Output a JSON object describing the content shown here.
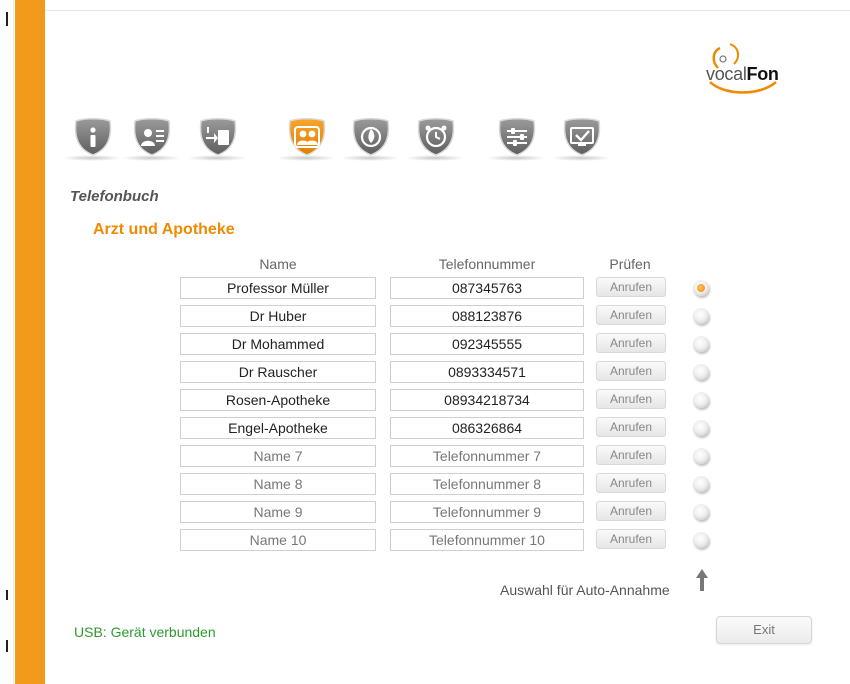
{
  "logo": {
    "part1": "vocal",
    "part2": "Fon"
  },
  "nav": [
    {
      "icon": "info-icon",
      "active": false
    },
    {
      "icon": "contact-card-icon",
      "active": false
    },
    {
      "icon": "phone-transfer-icon",
      "active": false
    },
    {
      "icon": "phonebook-people-icon",
      "active": true
    },
    {
      "icon": "emergency-flame-icon",
      "active": false
    },
    {
      "icon": "alarm-clock-icon",
      "active": false
    },
    {
      "icon": "settings-sliders-icon",
      "active": false
    },
    {
      "icon": "monitor-check-icon",
      "active": false
    }
  ],
  "section_title": "Telefonbuch",
  "sub_title": "Arzt und Apotheke",
  "columns": {
    "name": "Name",
    "phone": "Telefonnummer",
    "check": "Prüfen"
  },
  "call_label": "Anrufen",
  "rows": [
    {
      "name": "Professor Müller",
      "phone": "087345763",
      "placeholder": false,
      "selected": true
    },
    {
      "name": "Dr Huber",
      "phone": "088123876",
      "placeholder": false,
      "selected": false
    },
    {
      "name": "Dr Mohammed",
      "phone": "092345555",
      "placeholder": false,
      "selected": false
    },
    {
      "name": "Dr Rauscher",
      "phone": "0893334571",
      "placeholder": false,
      "selected": false
    },
    {
      "name": "Rosen-Apotheke",
      "phone": "08934218734",
      "placeholder": false,
      "selected": false
    },
    {
      "name": "Engel-Apotheke",
      "phone": "086326864",
      "placeholder": false,
      "selected": false
    },
    {
      "name": "Name 7",
      "phone": "Telefonnummer 7",
      "placeholder": true,
      "selected": false
    },
    {
      "name": "Name 8",
      "phone": "Telefonnummer 8",
      "placeholder": true,
      "selected": false
    },
    {
      "name": "Name 9",
      "phone": "Telefonnummer 9",
      "placeholder": true,
      "selected": false
    },
    {
      "name": "Name 10",
      "phone": "Telefonnummer 10",
      "placeholder": true,
      "selected": false
    }
  ],
  "auto_answer_label": "Auswahl für Auto-Annahme",
  "status": "USB: Gerät verbunden",
  "exit_label": "Exit",
  "colors": {
    "accent": "#f29a1c",
    "active_icon": "#f08a00",
    "status_ok": "#2e9a2e"
  }
}
